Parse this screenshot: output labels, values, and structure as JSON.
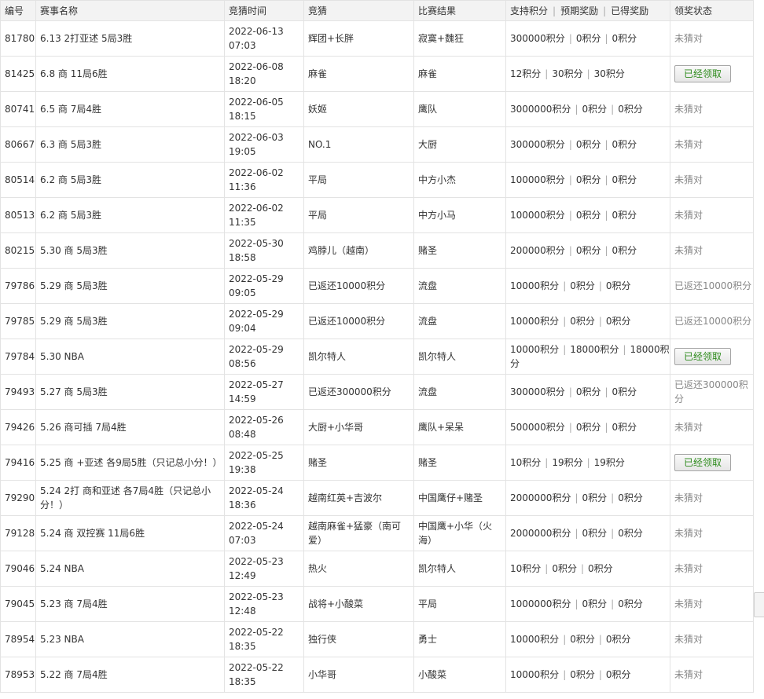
{
  "columns": {
    "id": "编号",
    "name": "赛事名称",
    "time": "竞猜时间",
    "guess": "竞猜",
    "result": "比赛结果",
    "support": "支持积分",
    "expected": "预期奖励",
    "earned": "已得奖励",
    "status": "领奖状态"
  },
  "rows": [
    {
      "id": "81780",
      "name": "6.13 2打亚述 5局3胜",
      "date": "2022-06-13",
      "clock": "07:03",
      "guess": "辉团+长胖",
      "result": "寂寞+魏狂",
      "support": "300000积分",
      "expected": "0积分",
      "earned": "0积分",
      "status": "未猜对",
      "status_type": "text"
    },
    {
      "id": "81425",
      "name": "6.8 商 11局6胜",
      "date": "2022-06-08",
      "clock": "18:20",
      "guess": "麻雀",
      "result": "麻雀",
      "support": "12积分",
      "expected": "30积分",
      "earned": "30积分",
      "status": "已经领取",
      "status_type": "button"
    },
    {
      "id": "80741",
      "name": "6.5 商 7局4胜",
      "date": "2022-06-05",
      "clock": "18:15",
      "guess": "妖姬",
      "result": "鹰队",
      "support": "3000000积分",
      "expected": "0积分",
      "earned": "0积分",
      "status": "未猜对",
      "status_type": "text"
    },
    {
      "id": "80667",
      "name": "6.3 商 5局3胜",
      "date": "2022-06-03",
      "clock": "19:05",
      "guess": "NO.1",
      "result": "大厨",
      "support": "300000积分",
      "expected": "0积分",
      "earned": "0积分",
      "status": "未猜对",
      "status_type": "text"
    },
    {
      "id": "80514",
      "name": "6.2 商 5局3胜",
      "date": "2022-06-02",
      "clock": "11:36",
      "guess": "平局",
      "result": "中方小杰",
      "support": "100000积分",
      "expected": "0积分",
      "earned": "0积分",
      "status": "未猜对",
      "status_type": "text"
    },
    {
      "id": "80513",
      "name": "6.2 商 5局3胜",
      "date": "2022-06-02",
      "clock": "11:35",
      "guess": "平局",
      "result": "中方小马",
      "support": "100000积分",
      "expected": "0积分",
      "earned": "0积分",
      "status": "未猜对",
      "status_type": "text"
    },
    {
      "id": "80215",
      "name": "5.30 商 5局3胜",
      "date": "2022-05-30",
      "clock": "18:58",
      "guess": "鸡脖儿（越南）",
      "result": "赌圣",
      "support": "200000积分",
      "expected": "0积分",
      "earned": "0积分",
      "status": "未猜对",
      "status_type": "text"
    },
    {
      "id": "79786",
      "name": "5.29 商 5局3胜",
      "date": "2022-05-29",
      "clock": "09:05",
      "guess": "已返还10000积分",
      "result": "流盘",
      "support": "10000积分",
      "expected": "0积分",
      "earned": "0积分",
      "status": "已返还10000积分",
      "status_type": "refund"
    },
    {
      "id": "79785",
      "name": "5.29 商 5局3胜",
      "date": "2022-05-29",
      "clock": "09:04",
      "guess": "已返还10000积分",
      "result": "流盘",
      "support": "10000积分",
      "expected": "0积分",
      "earned": "0积分",
      "status": "已返还10000积分",
      "status_type": "refund"
    },
    {
      "id": "79784",
      "name": "5.30 NBA",
      "date": "2022-05-29",
      "clock": "08:56",
      "guess": "凯尔特人",
      "result": "凯尔特人",
      "support": "10000积分",
      "expected": "18000积分",
      "earned": "18000积分",
      "status": "已经领取",
      "status_type": "button"
    },
    {
      "id": "79493",
      "name": "5.27 商 5局3胜",
      "date": "2022-05-27",
      "clock": "14:59",
      "guess": "已返还300000积分",
      "result": "流盘",
      "support": "300000积分",
      "expected": "0积分",
      "earned": "0积分",
      "status": "已返还300000积分",
      "status_type": "refund"
    },
    {
      "id": "79426",
      "name": "5.26 商可插 7局4胜",
      "date": "2022-05-26",
      "clock": "08:48",
      "guess": "大厨+小华哥",
      "result": "鹰队+呆呆",
      "support": "500000积分",
      "expected": "0积分",
      "earned": "0积分",
      "status": "未猜对",
      "status_type": "text"
    },
    {
      "id": "79416",
      "name": "5.25 商 +亚述 各9局5胜（只记总小分！）",
      "date": "2022-05-25",
      "clock": "19:38",
      "guess": "赌圣",
      "result": "赌圣",
      "support": "10积分",
      "expected": "19积分",
      "earned": "19积分",
      "status": "已经领取",
      "status_type": "button"
    },
    {
      "id": "79290",
      "name": "5.24 2打 商和亚述 各7局4胜（只记总小分！）",
      "date": "2022-05-24",
      "clock": "18:36",
      "guess": "越南红英+吉波尔",
      "result": "中国鹰仔+赌圣",
      "support": "2000000积分",
      "expected": "0积分",
      "earned": "0积分",
      "status": "未猜对",
      "status_type": "text"
    },
    {
      "id": "79128",
      "name": "5.24 商 双控赛 11局6胜",
      "date": "2022-05-24",
      "clock": "07:03",
      "guess": "越南麻雀+猛豪（南可爱）",
      "result": "中国鹰+小华（火海）",
      "support": "2000000积分",
      "expected": "0积分",
      "earned": "0积分",
      "status": "未猜对",
      "status_type": "text"
    },
    {
      "id": "79046",
      "name": "5.24 NBA",
      "date": "2022-05-23",
      "clock": "12:49",
      "guess": "热火",
      "result": "凯尔特人",
      "support": "10积分",
      "expected": "0积分",
      "earned": "0积分",
      "status": "未猜对",
      "status_type": "text"
    },
    {
      "id": "79045",
      "name": "5.23 商 7局4胜",
      "date": "2022-05-23",
      "clock": "12:48",
      "guess": "战将+小酸菜",
      "result": "平局",
      "support": "1000000积分",
      "expected": "0积分",
      "earned": "0积分",
      "status": "未猜对",
      "status_type": "text"
    },
    {
      "id": "78954",
      "name": "5.23 NBA",
      "date": "2022-05-22",
      "clock": "18:35",
      "guess": "独行侠",
      "result": "勇士",
      "support": "10000积分",
      "expected": "0积分",
      "earned": "0积分",
      "status": "未猜对",
      "status_type": "text"
    },
    {
      "id": "78953",
      "name": "5.22 商 7局4胜",
      "date": "2022-05-22",
      "clock": "18:35",
      "guess": "小华哥",
      "result": "小酸菜",
      "support": "10000积分",
      "expected": "0积分",
      "earned": "0积分",
      "status": "未猜对",
      "status_type": "text"
    }
  ],
  "colors": {
    "header_bg": "#f3f3f3",
    "border": "#e3e3e3",
    "claim_text": "#2e8b1d",
    "status_text": "#888888"
  }
}
